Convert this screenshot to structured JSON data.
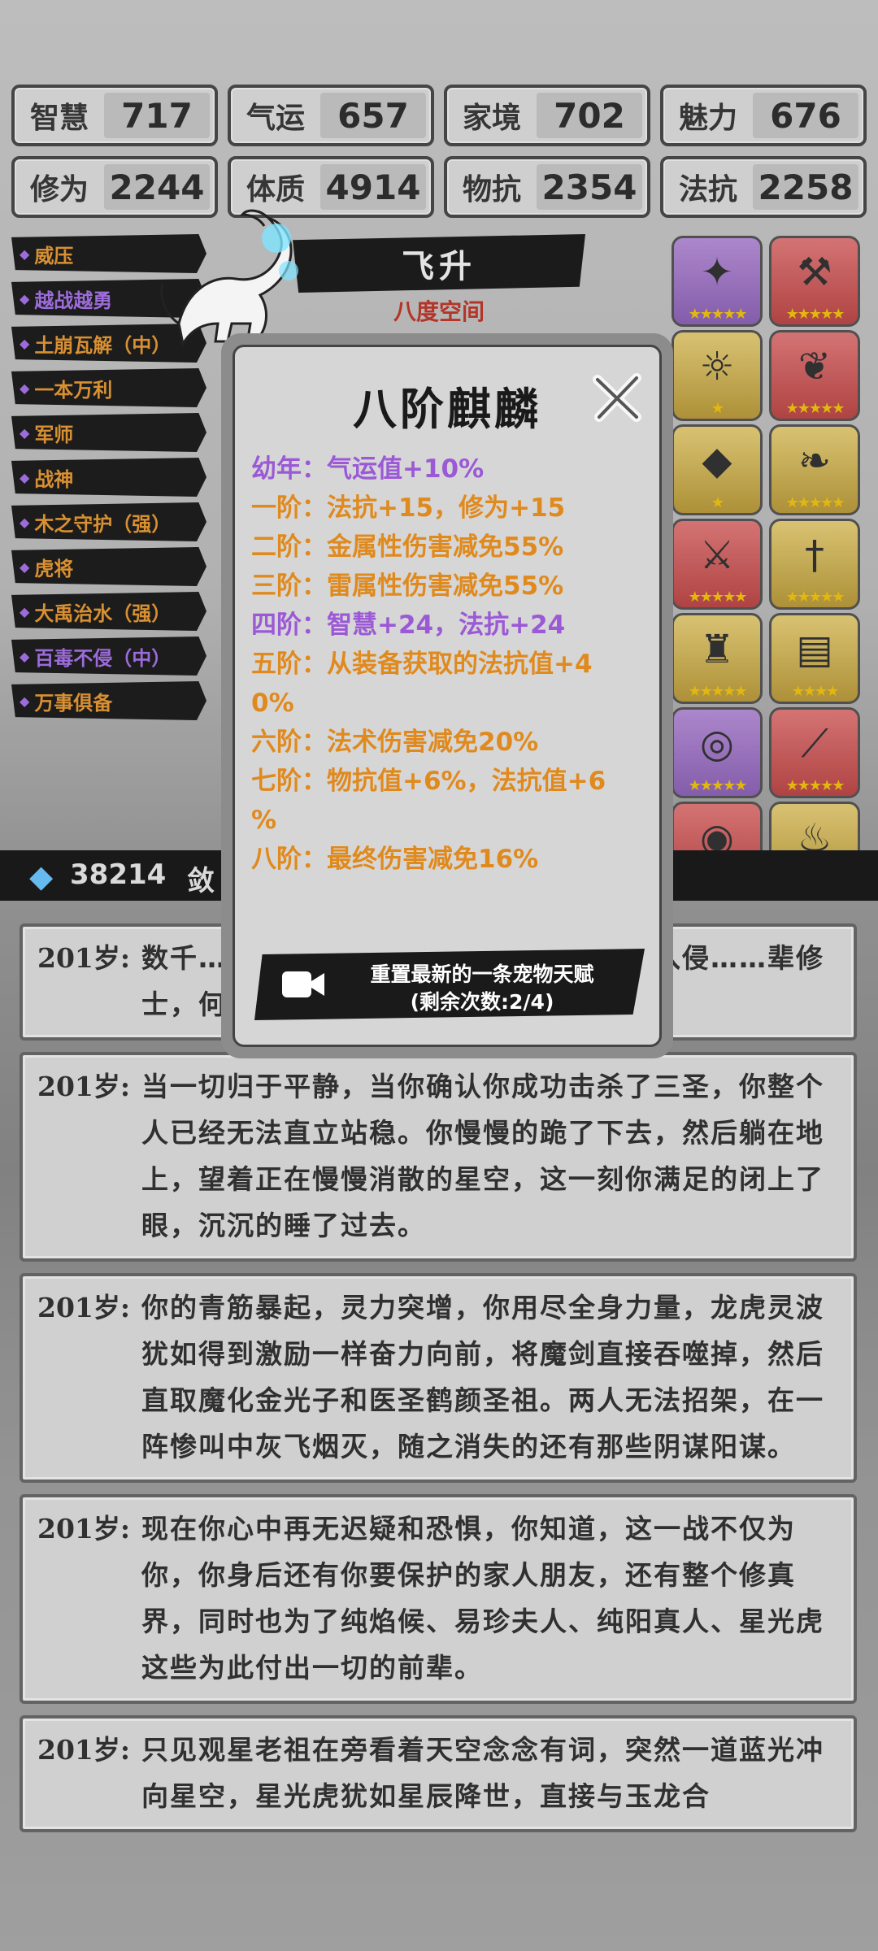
{
  "stats": [
    [
      {
        "k": "智慧",
        "v": "717"
      },
      {
        "k": "气运",
        "v": "657"
      },
      {
        "k": "家境",
        "v": "702"
      },
      {
        "k": "魅力",
        "v": "676"
      }
    ],
    [
      {
        "k": "修为",
        "v": "2244"
      },
      {
        "k": "体质",
        "v": "4914"
      },
      {
        "k": "物抗",
        "v": "2354"
      },
      {
        "k": "法抗",
        "v": "2258"
      }
    ]
  ],
  "talents": [
    {
      "label": "威压",
      "color": "orange"
    },
    {
      "label": "越战越勇",
      "color": "purple"
    },
    {
      "label": "土崩瓦解（中）",
      "color": "orange"
    },
    {
      "label": "一本万利",
      "color": "orange"
    },
    {
      "label": "军师",
      "color": "orange"
    },
    {
      "label": "战神",
      "color": "orange"
    },
    {
      "label": "木之守护（强）",
      "color": "orange"
    },
    {
      "label": "虎将",
      "color": "orange"
    },
    {
      "label": "大禹治水（强）",
      "color": "orange"
    },
    {
      "label": "百毒不侵（中）",
      "color": "purple"
    },
    {
      "label": "万事俱备",
      "color": "orange"
    }
  ],
  "banner": {
    "title": "飞升",
    "subtitle": "八度空间"
  },
  "items": [
    {
      "bg": "purple",
      "icon": "crossbow-icon",
      "glyph": "✦",
      "stars": "★★★★★"
    },
    {
      "bg": "red",
      "icon": "axe-icon",
      "glyph": "⚒",
      "stars": "★★★★★"
    },
    {
      "bg": "gold",
      "icon": "staff-icon",
      "glyph": "☼",
      "stars": "★"
    },
    {
      "bg": "red",
      "icon": "phoenix-icon",
      "glyph": "❦",
      "stars": "★★★★★"
    },
    {
      "bg": "gold",
      "icon": "crystal-icon",
      "glyph": "◆",
      "stars": "★"
    },
    {
      "bg": "gold",
      "icon": "boot-icon",
      "glyph": "❧",
      "stars": "★★★★★"
    },
    {
      "bg": "red",
      "icon": "sword-icon",
      "glyph": "⚔",
      "stars": "★★★★★"
    },
    {
      "bg": "gold",
      "icon": "dagger-icon",
      "glyph": "†",
      "stars": "★★★★★"
    },
    {
      "bg": "gold",
      "icon": "armor-icon",
      "glyph": "♜",
      "stars": "★★★★★"
    },
    {
      "bg": "gold",
      "icon": "scroll-icon",
      "glyph": "▤",
      "stars": "★★★★"
    },
    {
      "bg": "purple",
      "icon": "ring-icon",
      "glyph": "◎",
      "stars": "★★★★★"
    },
    {
      "bg": "red",
      "icon": "spear-icon",
      "glyph": "⟋",
      "stars": "★★★★★"
    },
    {
      "bg": "red",
      "icon": "mirror-icon",
      "glyph": "◉",
      "stars": "★★"
    },
    {
      "bg": "gold",
      "icon": "teapot-icon",
      "glyph": "♨",
      "stars": "★"
    }
  ],
  "currency": {
    "value": "38214",
    "trailing": "敛"
  },
  "modal": {
    "title": "八阶麒麟",
    "lines": [
      {
        "text": "幼年：气运值+10%",
        "color": "purple"
      },
      {
        "text": "一阶：法抗+15，修为+15",
        "color": "orange"
      },
      {
        "text": "二阶：金属性伤害减免55%",
        "color": "orange"
      },
      {
        "text": "三阶：雷属性伤害减免55%",
        "color": "orange"
      },
      {
        "text": "四阶：智慧+24，法抗+24",
        "color": "purple"
      },
      {
        "text": "五阶：从装备获取的法抗值+4",
        "color": "orange"
      },
      {
        "text": "0%",
        "color": "orange"
      },
      {
        "text": "六阶：法术伤害减免20%",
        "color": "orange"
      },
      {
        "text": "七阶：物抗值+6%，法抗值+6",
        "color": "orange"
      },
      {
        "text": "%",
        "color": "orange"
      },
      {
        "text": "八阶：最终伤害减免16%",
        "color": "orange"
      }
    ],
    "reset_line1": "重置最新的一条宠物天赋",
    "reset_line2": "(剩余次数:2/4)"
  },
  "log": [
    {
      "age": "201岁:",
      "text": "数千……人在时空之门，……百万之众的入侵……辈修士，何惜一战”！"
    },
    {
      "age": "201岁:",
      "text": "当一切归于平静，当你确认你成功击杀了三圣，你整个人已经无法直立站稳。你慢慢的跪了下去，然后躺在地上，望着正在慢慢消散的星空，这一刻你满足的闭上了眼，沉沉的睡了过去。"
    },
    {
      "age": "201岁:",
      "text": "你的青筋暴起，灵力突增，你用尽全身力量，龙虎灵波犹如得到激励一样奋力向前，将魔剑直接吞噬掉，然后直取魔化金光子和医圣鹤颜圣祖。两人无法招架，在一阵惨叫中灰飞烟灭，随之消失的还有那些阴谋阳谋。"
    },
    {
      "age": "201岁:",
      "text": "现在你心中再无迟疑和恐惧，你知道，这一战不仅为你，你身后还有你要保护的家人朋友，还有整个修真界，同时也为了纯焰候、易珍夫人、纯阳真人、星光虎这些为此付出一切的前辈。"
    },
    {
      "age": "201岁:",
      "text": "只见观星老祖在旁看着天空念念有词，突然一道蓝光冲向星空，星光虎犹如星辰降世，直接与玉龙合"
    }
  ]
}
